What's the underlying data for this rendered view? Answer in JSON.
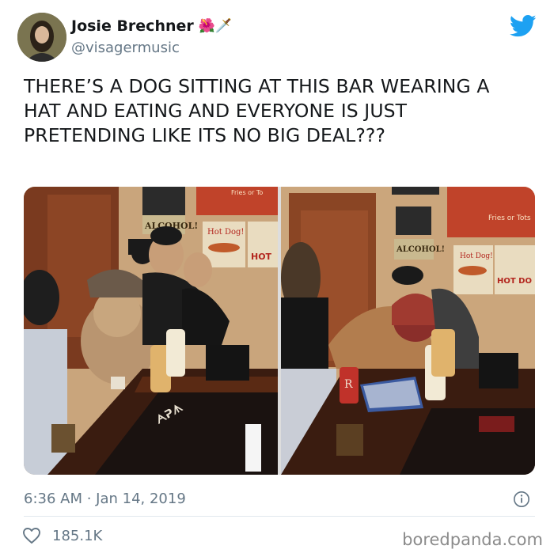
{
  "author": {
    "name": "Josie Brechner",
    "emoji": "🌺🗡️",
    "handle": "@visagermusic"
  },
  "tweet": {
    "text": "THERE’S A DOG SITTING AT THIS BAR WEARING A HAT AND EATING AND EVERYONE IS JUST PRETENDING LIKE ITS NO BIG DEAL???",
    "timestamp": "6:36 AM · Jan 14, 2019",
    "likes": "185.1K"
  },
  "photos": {
    "left_signs": [
      "Fries or To",
      "Hot Dog!",
      "HOT",
      "ALCOHOL!"
    ],
    "right_signs": [
      "Fries or Tots",
      "Hot Dog!",
      "HOT DO",
      "ALCOHOL!"
    ]
  },
  "watermark": "boredpanda.com",
  "colors": {
    "twitter_blue": "#1da1f2",
    "text": "#14171a",
    "muted": "#657786"
  },
  "icons": {
    "brand": "twitter-bird-icon",
    "info": "info-icon",
    "like": "heart-icon"
  }
}
